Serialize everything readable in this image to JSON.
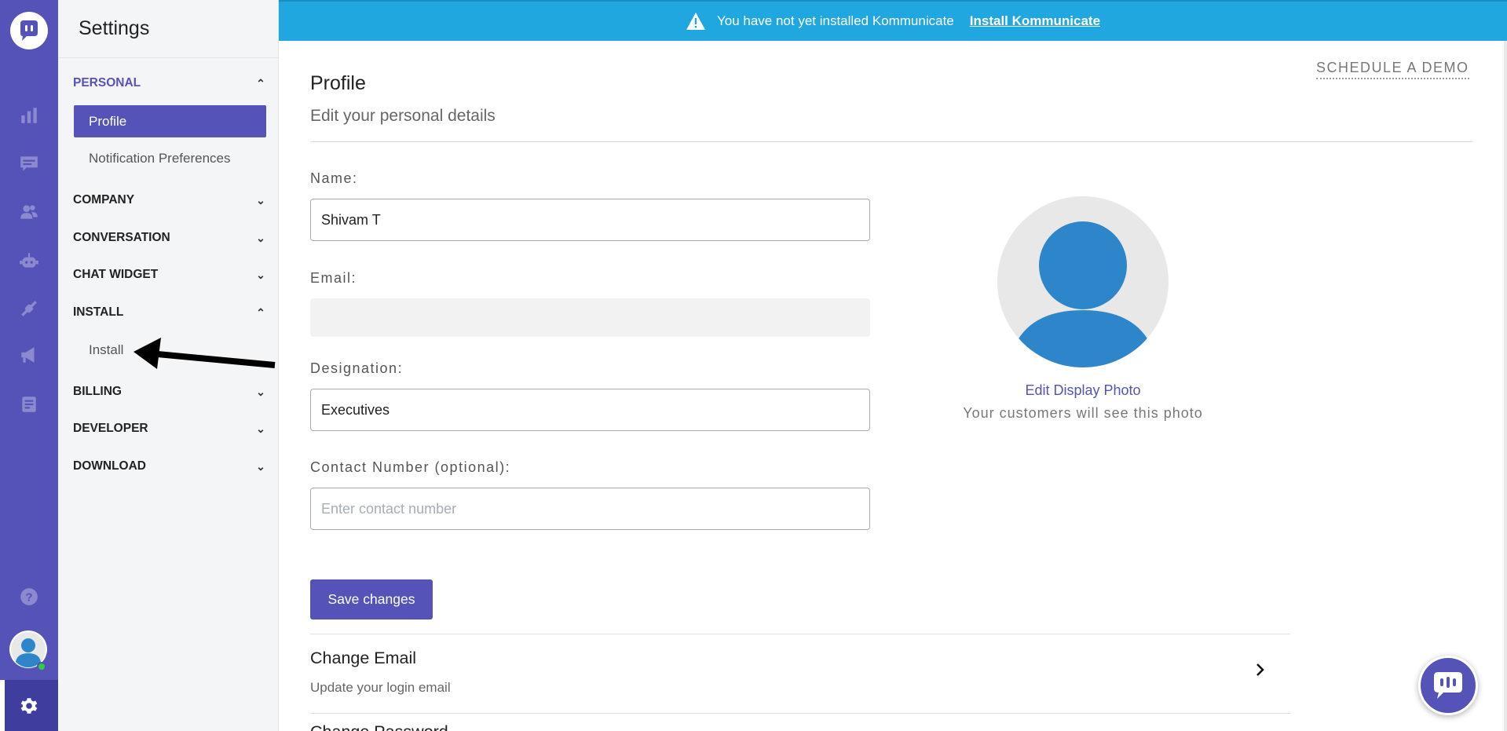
{
  "banner": {
    "message": "You have not yet installed Kommunicate",
    "link": "Install Kommunicate",
    "color": "#20a7e0"
  },
  "rail": {
    "accent": "#5553b7",
    "icons": [
      "chat-logo-icon",
      "analytics-icon",
      "conversations-icon",
      "users-icon",
      "bot-icon",
      "integrations-icon",
      "campaigns-icon",
      "reports-icon",
      "help-icon",
      "user-avatar",
      "settings-icon"
    ]
  },
  "sidebar": {
    "title": "Settings",
    "sections": [
      {
        "label": "PERSONAL",
        "open": true,
        "items": [
          "Profile",
          "Notification Preferences"
        ]
      },
      {
        "label": "COMPANY",
        "open": false
      },
      {
        "label": "CONVERSATION",
        "open": false
      },
      {
        "label": "CHAT WIDGET",
        "open": false
      },
      {
        "label": "INSTALL",
        "open": true,
        "items": [
          "Install"
        ]
      },
      {
        "label": "BILLING",
        "open": false
      },
      {
        "label": "DEVELOPER",
        "open": false
      },
      {
        "label": "DOWNLOAD",
        "open": false
      }
    ]
  },
  "main": {
    "schedule_demo": "SCHEDULE A DEMO",
    "title": "Profile",
    "subtitle": "Edit your personal details",
    "form": {
      "name_label": "Name:",
      "name_value": "Shivam T",
      "email_label": "Email:",
      "email_value": "",
      "designation_label": "Designation:",
      "designation_value": "Executives",
      "contact_label": "Contact Number (optional):",
      "contact_placeholder": "Enter contact number",
      "save_label": "Save changes"
    },
    "photo": {
      "edit_label": "Edit Display Photo",
      "hint": "Your customers will see this photo"
    },
    "rows": [
      {
        "title": "Change Email",
        "subtitle": "Update your login email"
      },
      {
        "title": "Change Password"
      }
    ]
  }
}
